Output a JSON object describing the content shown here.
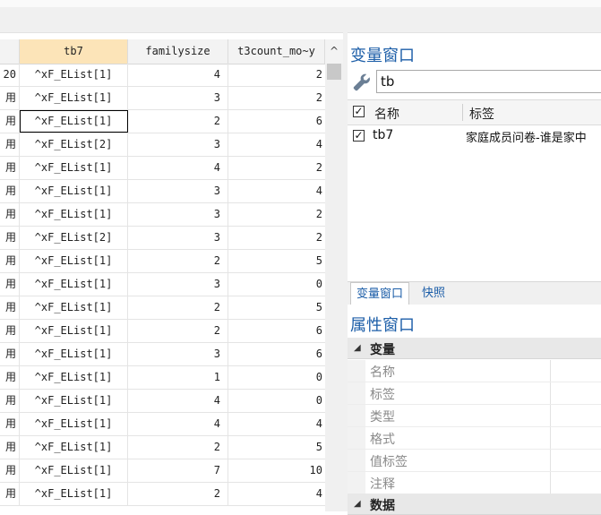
{
  "grid": {
    "columns": [
      "tb7",
      "familysize",
      "t3count_mo~y"
    ],
    "scroll_up_glyph": "^",
    "rows": [
      {
        "c0": "20",
        "tb7": "^xF_EList[1]",
        "familysize": "4",
        "t3count": "2"
      },
      {
        "c0": "用",
        "tb7": "^xF_EList[1]",
        "familysize": "3",
        "t3count": "2"
      },
      {
        "c0": "用",
        "tb7": "^xF_EList[1]",
        "familysize": "2",
        "t3count": "6"
      },
      {
        "c0": "用",
        "tb7": "^xF_EList[2]",
        "familysize": "3",
        "t3count": "4"
      },
      {
        "c0": "用",
        "tb7": "^xF_EList[1]",
        "familysize": "4",
        "t3count": "2"
      },
      {
        "c0": "用",
        "tb7": "^xF_EList[1]",
        "familysize": "3",
        "t3count": "4"
      },
      {
        "c0": "用",
        "tb7": "^xF_EList[1]",
        "familysize": "3",
        "t3count": "2"
      },
      {
        "c0": "用",
        "tb7": "^xF_EList[2]",
        "familysize": "3",
        "t3count": "2"
      },
      {
        "c0": "用",
        "tb7": "^xF_EList[1]",
        "familysize": "2",
        "t3count": "5"
      },
      {
        "c0": "用",
        "tb7": "^xF_EList[1]",
        "familysize": "3",
        "t3count": "0"
      },
      {
        "c0": "用",
        "tb7": "^xF_EList[1]",
        "familysize": "2",
        "t3count": "5"
      },
      {
        "c0": "用",
        "tb7": "^xF_EList[1]",
        "familysize": "2",
        "t3count": "6"
      },
      {
        "c0": "用",
        "tb7": "^xF_EList[1]",
        "familysize": "3",
        "t3count": "6"
      },
      {
        "c0": "用",
        "tb7": "^xF_EList[1]",
        "familysize": "1",
        "t3count": "0"
      },
      {
        "c0": "用",
        "tb7": "^xF_EList[1]",
        "familysize": "4",
        "t3count": "0"
      },
      {
        "c0": "用",
        "tb7": "^xF_EList[1]",
        "familysize": "4",
        "t3count": "4"
      },
      {
        "c0": "用",
        "tb7": "^xF_EList[1]",
        "familysize": "2",
        "t3count": "5"
      },
      {
        "c0": "用",
        "tb7": "^xF_EList[1]",
        "familysize": "7",
        "t3count": "10"
      },
      {
        "c0": "用",
        "tb7": "^xF_EList[1]",
        "familysize": "2",
        "t3count": "4"
      }
    ]
  },
  "variable_window": {
    "title": "变量窗口",
    "search_value": "tb",
    "header_name": "名称",
    "header_label": "标签",
    "check_glyph": "✓",
    "variable": {
      "name": "tb7",
      "label": "家庭成员问卷-谁是家中"
    }
  },
  "tabs": [
    "变量窗口",
    "快照"
  ],
  "properties_window": {
    "title": "属性窗口",
    "group_variables": "变量",
    "items": [
      "名称",
      "标签",
      "类型",
      "格式",
      "值标签",
      "注释"
    ],
    "group_data": "数据",
    "collapse_glyph": "◢"
  },
  "colors": {
    "accent": "#1c5ea8",
    "selected_header": "#fce4b8"
  }
}
